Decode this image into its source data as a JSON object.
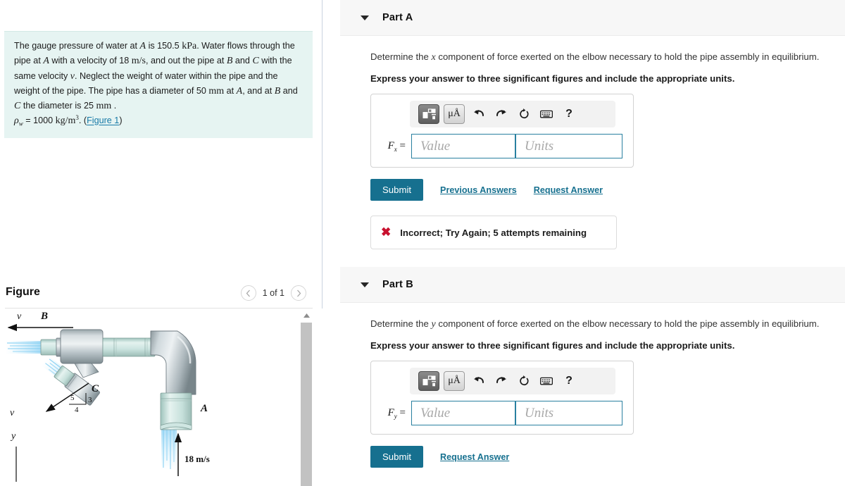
{
  "problem": {
    "line1_a": "The gauge pressure of water at ",
    "sym_A": "A",
    "line1_b": " is 150.5 ",
    "unit_kPa": "kPa",
    "line1_c": ". Water flows",
    "line2_a": "through the pipe at ",
    "line2_b": " with a velocity of 18 ",
    "unit_ms": "m/s",
    "line2_c": ", and out the pipe at",
    "sym_B": "B",
    "line3_a": " and ",
    "sym_C": "C",
    "line3_b": " with the same velocity ",
    "sym_v": "v",
    "line3_c": ". Neglect the weight of water",
    "line4": "within the pipe and the weight of the pipe. The pipe has a diameter",
    "line5_a": "of 50 ",
    "unit_mm": "mm",
    "line5_b": " at ",
    "line5_c": ", and at ",
    "line5_d": " the diameter is 25 ",
    "line5_e": " .",
    "rho_sym": "ρ",
    "rho_sub": "w",
    "rho_eq": " = 1000 ",
    "rho_unit": "kg/m",
    "rho_exp": "3",
    "rho_dot": ". (",
    "figure_link": "Figure 1",
    "rho_close": ")"
  },
  "figure": {
    "title": "Figure",
    "prev_icon": "chevron-left",
    "next_icon": "chevron-right",
    "counter": "1 of 1",
    "labels": {
      "B": "B",
      "C": "C",
      "A": "A",
      "v_top": "v",
      "v_left": "v",
      "y": "y",
      "tri_5": "5",
      "tri_3": "3",
      "tri_4": "4",
      "velocity": "18 m/s"
    },
    "colors": {
      "pipe_light": "#e8edef",
      "pipe_mid": "#b9c4c8",
      "pipe_dark": "#8d999e",
      "glass": "#cfe6e2",
      "water": "#8ed0f2"
    }
  },
  "parts": [
    {
      "id": "part-a",
      "label": "Part A",
      "caret_icon": "caret-down-icon",
      "question": "Determine the x component of force exerted on the elbow necessary to hold the pipe assembly in equilibrium.",
      "question_prefix": "Determine the ",
      "question_var": "x",
      "question_suffix": " component of force exerted on the elbow necessary to hold the pipe assembly in equilibrium.",
      "instruction": "Express your answer to three significant figures and include the appropriate units.",
      "toolbar": {
        "template_icon": "math-template-icon",
        "units_icon": "μÅ",
        "undo_icon": "↰",
        "redo_icon": "↱",
        "reset_icon": "↻",
        "keyboard_icon": "⌨",
        "help_icon": "?"
      },
      "answer": {
        "symbol": "F",
        "symbol_sub": "x",
        "equals": "=",
        "value_placeholder": "Value",
        "units_placeholder": "Units",
        "value": "",
        "units": ""
      },
      "submit_label": "Submit",
      "links": [
        "Previous Answers",
        "Request Answer"
      ],
      "feedback": {
        "icon": "x-mark-icon",
        "text": "Incorrect; Try Again; 5 attempts remaining"
      }
    },
    {
      "id": "part-b",
      "label": "Part B",
      "caret_icon": "caret-down-icon",
      "question_prefix": "Determine the ",
      "question_var": "y",
      "question_suffix": " component of force exerted on the elbow necessary to hold the pipe assembly in equilibrium.",
      "instruction": "Express your answer to three significant figures and include the appropriate units.",
      "toolbar": {
        "template_icon": "math-template-icon",
        "units_icon": "μÅ",
        "undo_icon": "↰",
        "redo_icon": "↱",
        "reset_icon": "↻",
        "keyboard_icon": "⌨",
        "help_icon": "?"
      },
      "answer": {
        "symbol": "F",
        "symbol_sub": "y",
        "equals": "=",
        "value_placeholder": "Value",
        "units_placeholder": "Units",
        "value": "",
        "units": ""
      },
      "submit_label": "Submit",
      "links": [
        "Request Answer"
      ],
      "feedback": null
    }
  ],
  "colors": {
    "accent": "#16708f",
    "problem_bg": "#e6f4f2",
    "header_bg": "#f7f7f7",
    "error": "#c8102e",
    "field_border": "#2980a0"
  }
}
